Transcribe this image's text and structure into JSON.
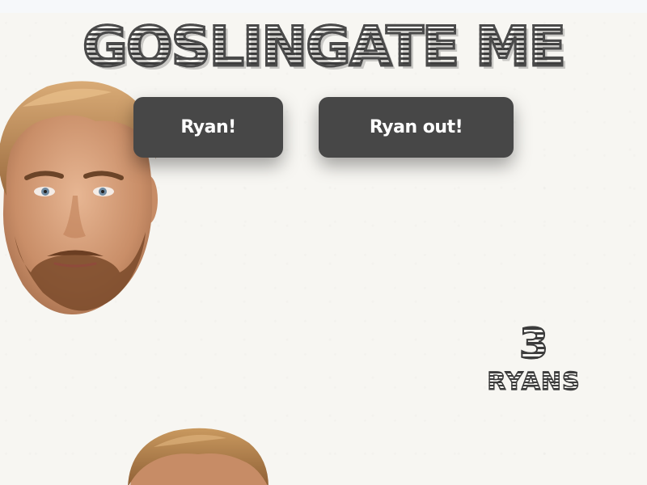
{
  "header": {
    "title": "GOSLINGATE ME"
  },
  "controls": {
    "add_label": "Ryan!",
    "remove_label": "Ryan out!"
  },
  "counter": {
    "count": "3",
    "unit": "RYANS"
  },
  "colors": {
    "background": "#f7f6f2",
    "button": "#474747",
    "button_text": "#ffffff",
    "title": "#4a4a4a"
  }
}
